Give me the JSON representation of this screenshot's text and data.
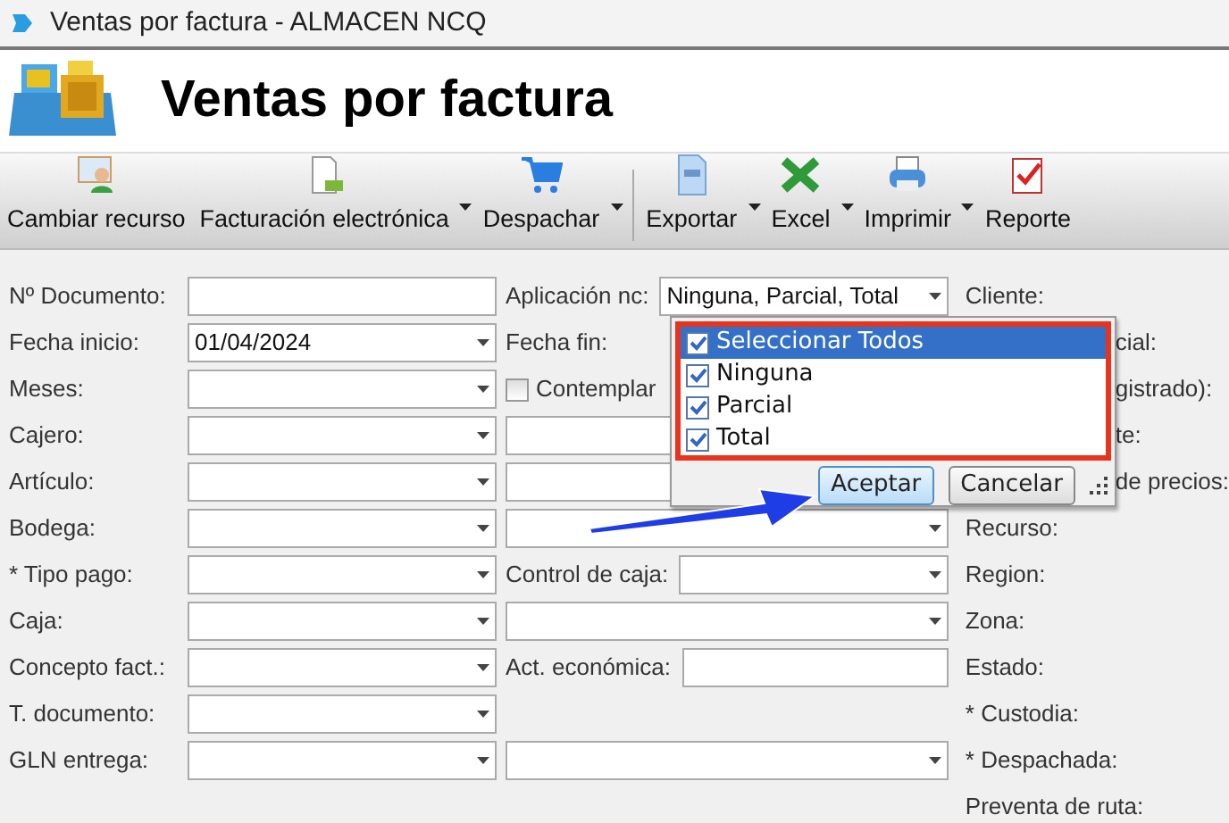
{
  "window": {
    "title": "Ventas por factura - ALMACEN NCQ"
  },
  "header": {
    "title": "Ventas por factura"
  },
  "toolbar": [
    {
      "label": "Cambiar recurso",
      "kind": "user",
      "caret": false,
      "separator_after": false
    },
    {
      "label": "Facturación electrónica",
      "kind": "document",
      "caret": true,
      "separator_after": false
    },
    {
      "label": "Despachar",
      "kind": "cart",
      "caret": true,
      "separator_after": true
    },
    {
      "label": "Exportar",
      "kind": "file",
      "caret": true,
      "separator_after": false
    },
    {
      "label": "Excel",
      "kind": "excel",
      "caret": true,
      "separator_after": false
    },
    {
      "label": "Imprimir",
      "kind": "printer",
      "caret": true,
      "separator_after": false
    },
    {
      "label": "Reporte",
      "kind": "report",
      "caret": false,
      "separator_after": false
    }
  ],
  "left_fields": [
    {
      "label": "Nº Documento:",
      "kind": "text"
    },
    {
      "label": "Fecha inicio:",
      "kind": "combo",
      "value": "01/04/2024"
    },
    {
      "label": "Meses:",
      "kind": "combo"
    },
    {
      "label": "Cajero:",
      "kind": "combo"
    },
    {
      "label": "Artículo:",
      "kind": "combo"
    },
    {
      "label": "Bodega:",
      "kind": "combo"
    },
    {
      "label": "* Tipo pago:",
      "kind": "combo"
    },
    {
      "label": "Caja:",
      "kind": "combo"
    },
    {
      "label": "Concepto fact.:",
      "kind": "combo"
    },
    {
      "label": "T. documento:",
      "kind": "combo"
    },
    {
      "label": "GLN entrega:",
      "kind": "combo"
    }
  ],
  "middle_fields": [
    {
      "kind": "combo",
      "label": "Aplicación nc:",
      "value": "Ninguna, Parcial, Total"
    },
    {
      "kind": "label",
      "label": "Fecha fin:"
    },
    {
      "kind": "checkbox",
      "label": "Contemplar",
      "checked": false
    },
    {
      "kind": "wide"
    },
    {
      "kind": "wide"
    },
    {
      "kind": "wide"
    },
    {
      "kind": "combo",
      "label": "Control de caja:"
    },
    {
      "kind": "wide"
    },
    {
      "kind": "text",
      "label": "Act. económica:"
    },
    {
      "kind": "blank"
    },
    {
      "kind": "wide"
    }
  ],
  "right_labels": [
    {
      "label": "Cliente:",
      "kind": "full"
    },
    {
      "label": "cial:",
      "kind": "partial"
    },
    {
      "label": "gistrado):",
      "kind": "partial"
    },
    {
      "label": "te:",
      "kind": "partial"
    },
    {
      "label": "de precios:",
      "kind": "partial"
    },
    {
      "label": "Recurso:",
      "kind": "full"
    },
    {
      "label": "Region:",
      "kind": "full"
    },
    {
      "label": "Zona:",
      "kind": "full"
    },
    {
      "label": "Estado:",
      "kind": "full"
    },
    {
      "label": "* Custodia:",
      "kind": "full"
    },
    {
      "label": "* Despachada:",
      "kind": "full"
    },
    {
      "label": "Preventa de ruta:",
      "kind": "full"
    }
  ],
  "dropdown": {
    "items": [
      {
        "label": "Seleccionar Todos",
        "checked": true,
        "selected": true
      },
      {
        "label": "Ninguna",
        "checked": true,
        "selected": false
      },
      {
        "label": "Parcial",
        "checked": true,
        "selected": false
      },
      {
        "label": "Total",
        "checked": true,
        "selected": false
      }
    ],
    "buttons": [
      {
        "label": "Aceptar",
        "focused": true
      },
      {
        "label": "Cancelar",
        "focused": false
      }
    ]
  }
}
